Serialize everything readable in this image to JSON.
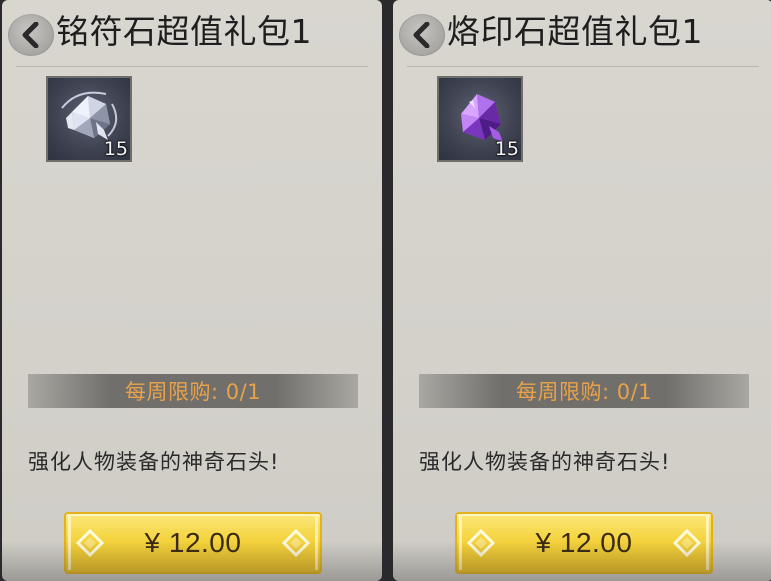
{
  "packs": [
    {
      "title": "铭符石超值礼包1",
      "item_icon": "silver-crystal-icon",
      "item_count": "15",
      "limit_text": "每周限购: 0/1",
      "description": "强化人物装备的神奇石头!",
      "price": "¥ 12.00"
    },
    {
      "title": "烙印石超值礼包1",
      "item_icon": "purple-crystal-icon",
      "item_count": "15",
      "limit_text": "每周限购: 0/1",
      "description": "强化人物装备的神奇石头!",
      "price": "¥ 12.00"
    }
  ],
  "colors": {
    "limit_text": "#e9a24a",
    "buy_button": "#f4d33e"
  }
}
